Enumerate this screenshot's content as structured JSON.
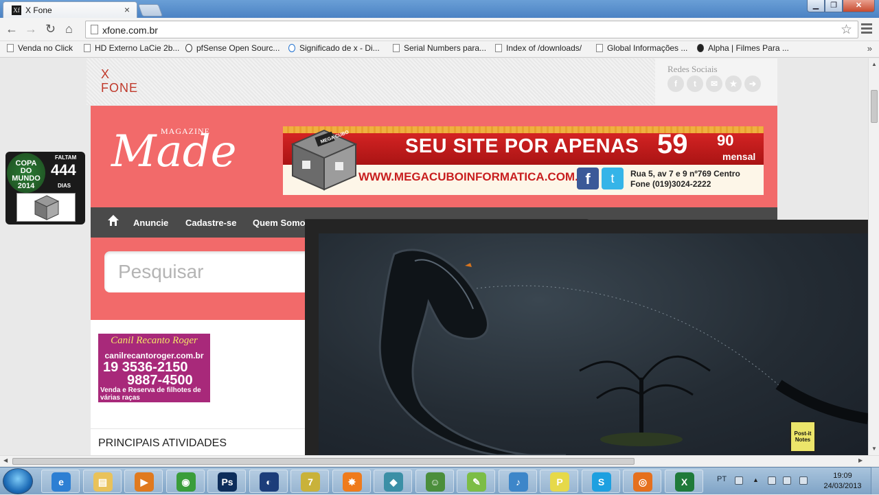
{
  "browser": {
    "tab_title": "X Fone",
    "tab_favicon": "Xf",
    "url": "xfone.com.br",
    "bookmarks": [
      {
        "label": "Venda no Click",
        "icon": "page-icon"
      },
      {
        "label": "HD Externo LaCie 2b...",
        "icon": "page-icon"
      },
      {
        "label": "pfSense Open Sourc...",
        "icon": "pfsense-icon"
      },
      {
        "label": "Significado de x - Di...",
        "icon": "d-icon"
      },
      {
        "label": "Serial Numbers para...",
        "icon": "page-icon"
      },
      {
        "label": "Index of /downloads/",
        "icon": "page-icon"
      },
      {
        "label": "Global Informações ...",
        "icon": "page-icon"
      },
      {
        "label": "Alpha | Filmes Para ...",
        "icon": "fd-icon"
      }
    ],
    "bookmarks_more": "»"
  },
  "site": {
    "logo_lines": [
      "X",
      "FONE"
    ],
    "social_title": "Redes Sociais",
    "social_icons": [
      "facebook-icon",
      "twitter-icon",
      "email-icon",
      "star-icon",
      "arrow-icon"
    ],
    "magazine_word": "MAGAZINE",
    "made_word": "Made",
    "ad": {
      "cube_text": "MEGA CUBO",
      "headline": "SEU SITE POR APENAS",
      "price": "59",
      "cents": "90",
      "period": "mensal",
      "url": "WWW.MEGACUBOINFORMATICA.COM.BR",
      "address_line1": "Rua 5, av 7 e 9 nº769 Centro",
      "address_line2": "Fone (019)3024-2222"
    },
    "nav": [
      "Anuncie",
      "Cadastre-se",
      "Quem Somo"
    ],
    "search_placeholder": "Pesquisar",
    "canil": {
      "title": "Canil Recanto Roger",
      "site": "canilrecantoroger.com.br",
      "phone1": "19 3536-2150",
      "phone2": "9887-4500",
      "desc": "Venda e Reserva de filhotes de várias raças"
    },
    "section_heading": "PRINCIPAIS ATIVIDADES"
  },
  "overlay": {
    "postit_label": "Post-it Notes"
  },
  "gadget": {
    "logo": "COPA DO MUNDO 2014",
    "faltam": "FALTAM",
    "count": "444",
    "dias": "DIAS"
  },
  "taskbar": {
    "apps": [
      {
        "name": "ie-icon",
        "glyph": "e",
        "color": "#2d7fd3"
      },
      {
        "name": "explorer-icon",
        "glyph": "▤",
        "color": "#e9c25a"
      },
      {
        "name": "media-player-icon",
        "glyph": "▶",
        "color": "#e07a1f"
      },
      {
        "name": "chrome-icon",
        "glyph": "◉",
        "color": "#3a9d3a"
      },
      {
        "name": "photoshop-icon",
        "glyph": "Ps",
        "color": "#0d2d5a"
      },
      {
        "name": "app-dark-icon",
        "glyph": "◐",
        "color": "#1c3d7a"
      },
      {
        "name": "7zip-icon",
        "glyph": "7",
        "color": "#c9b23a"
      },
      {
        "name": "avast-icon",
        "glyph": "✸",
        "color": "#ef7b1c"
      },
      {
        "name": "network-map-icon",
        "glyph": "◆",
        "color": "#3b8fa6"
      },
      {
        "name": "users-icon",
        "glyph": "☺",
        "color": "#4b8e3c"
      },
      {
        "name": "evernote-icon",
        "glyph": "✎",
        "color": "#7cbd46"
      },
      {
        "name": "itunes-icon",
        "glyph": "♪",
        "color": "#3d86c9"
      },
      {
        "name": "postit-icon",
        "glyph": "P",
        "color": "#e6d94a"
      },
      {
        "name": "skype-icon",
        "glyph": "S",
        "color": "#1da0e0"
      },
      {
        "name": "firefox-icon",
        "glyph": "◎",
        "color": "#e5701e"
      },
      {
        "name": "excel-icon",
        "glyph": "X",
        "color": "#1f7a3a"
      }
    ],
    "lang": "PT",
    "time": "19:09",
    "date": "24/03/2013"
  }
}
